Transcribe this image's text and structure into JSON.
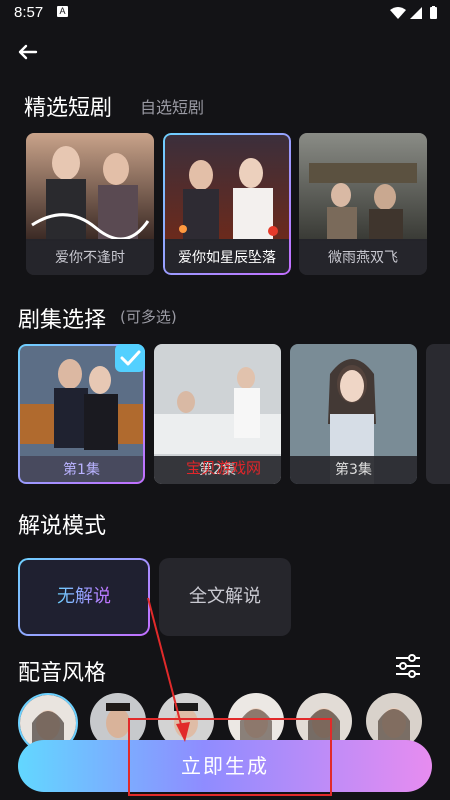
{
  "status_bar": {
    "time": "8:57",
    "notification_letter": "A"
  },
  "header": {
    "active_tab": "精选短剧",
    "inactive_tab": "自选短剧"
  },
  "dramas": [
    {
      "title": "爱你不逢时",
      "selected": false
    },
    {
      "title": "爱你如星辰坠落",
      "selected": true
    },
    {
      "title": "微雨燕双飞",
      "selected": false
    }
  ],
  "episodes": {
    "title": "剧集选择",
    "hint": "(可多选)",
    "items": [
      {
        "label": "第1集",
        "selected": true
      },
      {
        "label": "第2集",
        "selected": false
      },
      {
        "label": "第3集",
        "selected": false
      }
    ]
  },
  "narration": {
    "title": "解说模式",
    "options": [
      {
        "label": "无解说",
        "selected": true
      },
      {
        "label": "全文解说",
        "selected": false
      }
    ]
  },
  "voice": {
    "title": "配音风格",
    "filter_icon": "sliders-icon"
  },
  "cta": {
    "label": "立即生成"
  },
  "watermark": "宝贝游戏网",
  "colors": {
    "accent_start": "#62d7ff",
    "accent_mid": "#8f8cff",
    "accent_end": "#e78cf0",
    "annotation_red": "#e12a2a"
  }
}
